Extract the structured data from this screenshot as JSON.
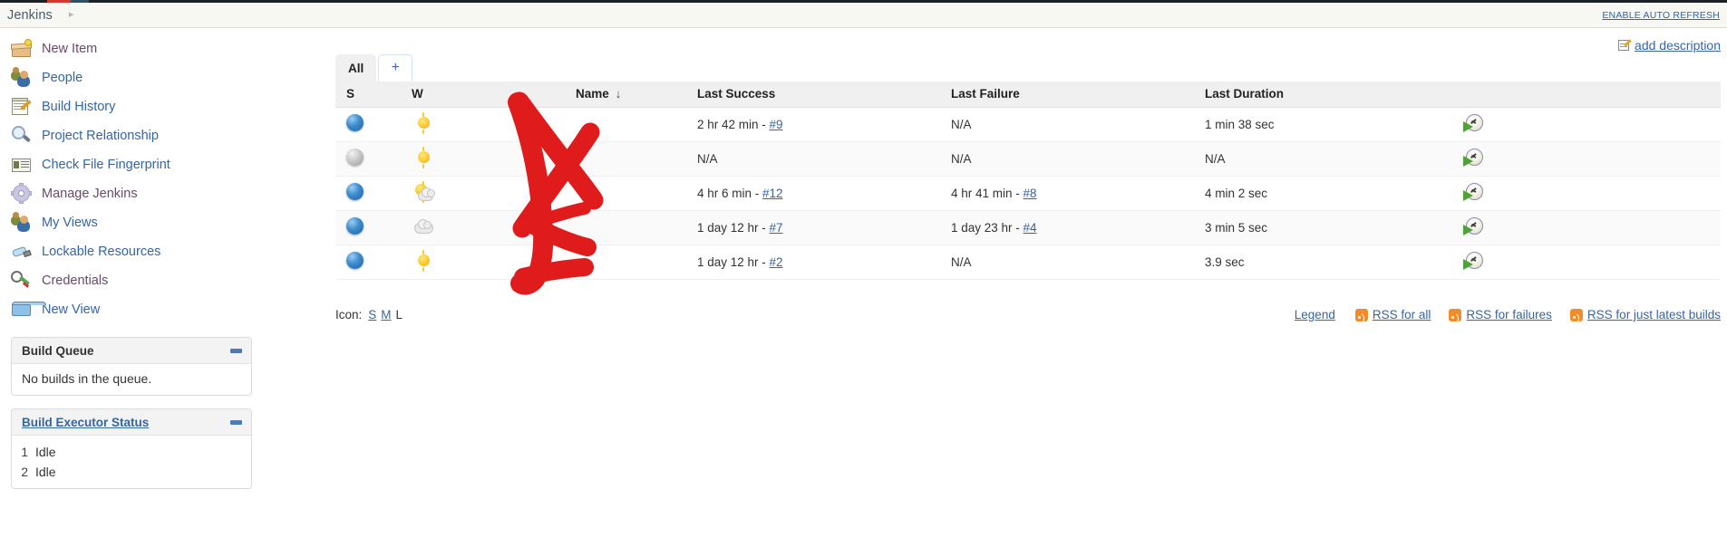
{
  "breadcrumb": {
    "root": "Jenkins",
    "separator": "▸",
    "auto_refresh_label": "ENABLE AUTO REFRESH"
  },
  "sidebar": {
    "tasks": [
      {
        "label": "New Item",
        "icon": "new-item-icon",
        "color": "plum"
      },
      {
        "label": "People",
        "icon": "people-icon",
        "color": "blue"
      },
      {
        "label": "Build History",
        "icon": "build-history-icon",
        "color": "blue"
      },
      {
        "label": "Project Relationship",
        "icon": "project-relationship-icon",
        "color": "blue"
      },
      {
        "label": "Check File Fingerprint",
        "icon": "check-file-fingerprint-icon",
        "color": "blue"
      },
      {
        "label": "Manage Jenkins",
        "icon": "manage-jenkins-icon",
        "color": "plum"
      },
      {
        "label": "My Views",
        "icon": "my-views-icon",
        "color": "blue"
      },
      {
        "label": "Lockable Resources",
        "icon": "lockable-resources-icon",
        "color": "blue"
      },
      {
        "label": "Credentials",
        "icon": "credentials-icon",
        "color": "plum"
      },
      {
        "label": "New View",
        "icon": "new-view-icon",
        "color": "blue"
      }
    ],
    "build_queue": {
      "title": "Build Queue",
      "empty_text": "No builds in the queue."
    },
    "build_executor_status": {
      "title": "Build Executor Status",
      "executors": [
        {
          "num": "1",
          "state": "Idle"
        },
        {
          "num": "2",
          "state": "Idle"
        }
      ]
    }
  },
  "main": {
    "add_description_label": "add description",
    "tabs": [
      {
        "label": "All",
        "active": true
      },
      {
        "label": "+",
        "active": false
      }
    ],
    "table": {
      "headers": {
        "s": "S",
        "w": "W",
        "name": "Name",
        "name_sort": "↓",
        "last_success": "Last Success",
        "last_failure": "Last Failure",
        "last_duration": "Last Duration",
        "actions": ""
      },
      "rows": [
        {
          "status": "blue",
          "weather": "sunny",
          "name": "",
          "last_success": "2 hr 42 min - ",
          "last_success_build": "#9",
          "last_failure": "N/A",
          "last_failure_build": "",
          "last_duration": "1 min 38 sec"
        },
        {
          "status": "grey",
          "weather": "sunny",
          "name": "",
          "last_success": "N/A",
          "last_success_build": "",
          "last_failure": "N/A",
          "last_failure_build": "",
          "last_duration": "N/A"
        },
        {
          "status": "blue",
          "weather": "partly",
          "name": "",
          "last_success": "4 hr 6 min - ",
          "last_success_build": "#12",
          "last_failure": "4 hr 41 min - ",
          "last_failure_build": "#8",
          "last_duration": "4 min 2 sec"
        },
        {
          "status": "blue",
          "weather": "cloudy",
          "name": "",
          "last_success": "1 day 12 hr - ",
          "last_success_build": "#7",
          "last_failure": "1 day 23 hr - ",
          "last_failure_build": "#4",
          "last_duration": "3 min 5 sec"
        },
        {
          "status": "blue",
          "weather": "sunny",
          "name": "",
          "last_success": "1 day 12 hr - ",
          "last_success_build": "#2",
          "last_failure": "N/A",
          "last_failure_build": "",
          "last_duration": "3.9 sec"
        }
      ]
    },
    "icon_size": {
      "label": "Icon:",
      "options": [
        "S",
        "M",
        "L"
      ],
      "selected": "L"
    },
    "footer_links": {
      "legend": "Legend",
      "rss_all": "RSS for all",
      "rss_failures": "RSS for failures",
      "rss_latest": "RSS for just latest builds"
    }
  },
  "colors": {
    "link": "#3465a4",
    "annotation": "#e01b1b",
    "tab_active_bg": "#f0f0f0",
    "header_bg": "#f0f0f0",
    "breadcrumb_bg": "#f7f8f3"
  }
}
